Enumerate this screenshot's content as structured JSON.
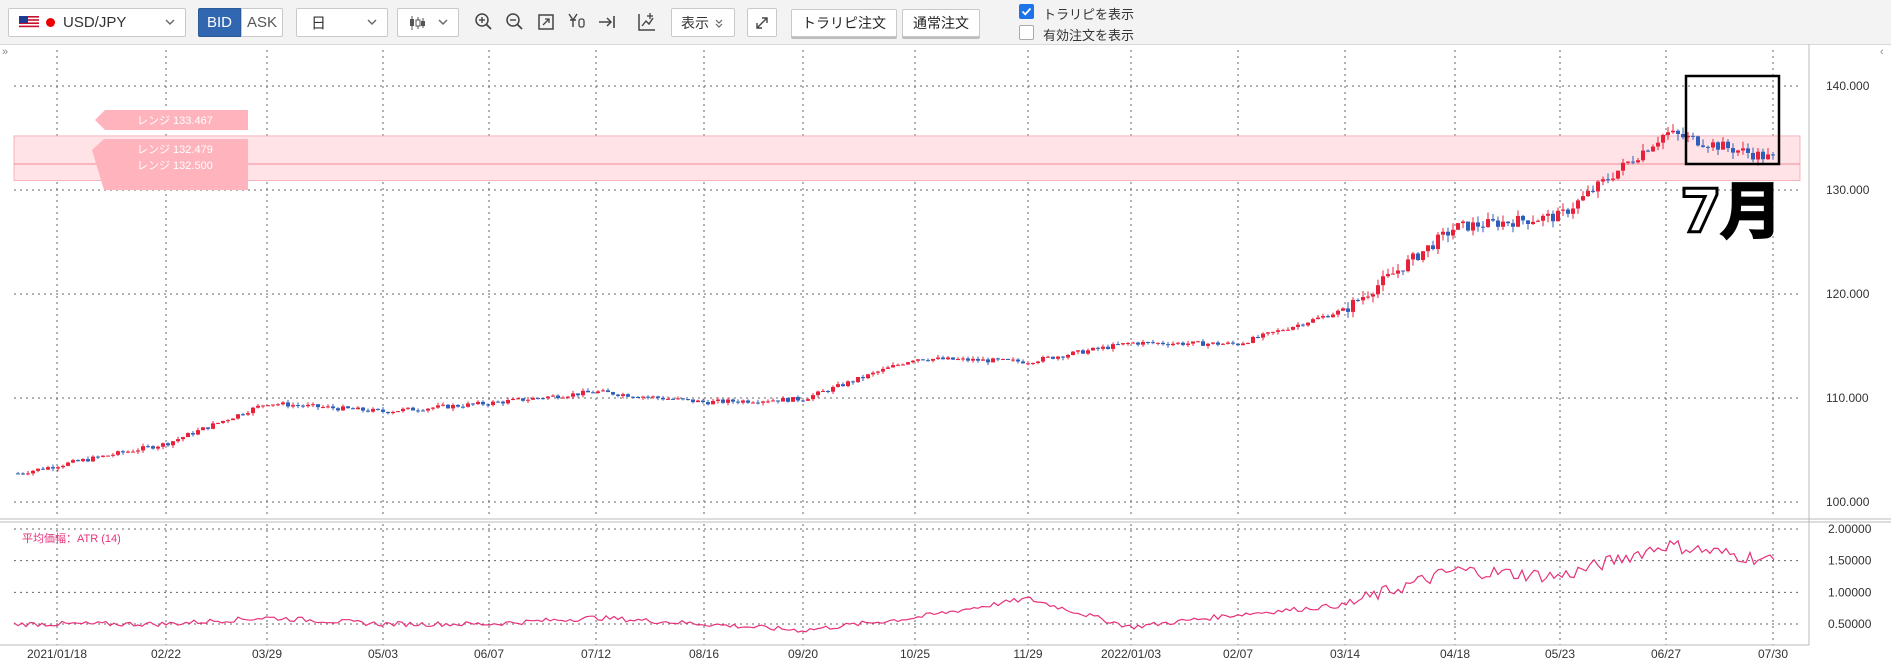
{
  "toolbar": {
    "symbol": "USD/JPY",
    "bid_label": "BID",
    "ask_label": "ASK",
    "period": "日",
    "display_label": "表示",
    "trail_order_label": "トラリピ注文",
    "normal_order_label": "通常注文",
    "show_trail_label": "トラリピを表示",
    "show_trail_checked": true,
    "show_valid_orders_label": "有効注文を表示",
    "show_valid_orders_checked": false,
    "icons": [
      "zoom-in-icon",
      "zoom-out-icon",
      "fit-icon",
      "cursor-yen-icon",
      "jump-latest-icon",
      "add-indicator-icon",
      "expand-icon"
    ]
  },
  "colors": {
    "up_candle": "#e8213b",
    "down_candle": "#2f5fba",
    "atr_line": "#e8307a",
    "range_band": "#ffd9dd",
    "accent": "#3166b0"
  },
  "range_labels": [
    "レンジ 133.467",
    "レンジ 132.479",
    "レンジ 132.500"
  ],
  "annotation": {
    "text": "7月"
  },
  "indicator": {
    "label": "平均価幅：ATR (14)"
  },
  "chart_data": [
    {
      "type": "candlestick",
      "title": "",
      "x": [
        "2021/01/18",
        "02/22",
        "03/29",
        "05/03",
        "06/07",
        "07/12",
        "08/16",
        "09/20",
        "10/25",
        "11/29",
        "2022/01/03",
        "02/07",
        "03/14",
        "04/18",
        "05/23",
        "06/27",
        "07/30"
      ],
      "close_approx": [
        103.5,
        105.6,
        109.5,
        108.7,
        109.5,
        110.6,
        109.6,
        109.9,
        113.8,
        113.5,
        115.3,
        115.2,
        118.5,
        126.4,
        127.5,
        135.5,
        133.0
      ],
      "ylim": [
        100,
        140
      ],
      "yticks": [
        "100.000",
        "110.000",
        "120.000",
        "130.000",
        "140.000"
      ],
      "range_band": [
        130.9,
        135.2
      ],
      "grid": true
    },
    {
      "type": "line",
      "title": "平均価幅：ATR (14)",
      "x": [
        "2021/01/18",
        "02/22",
        "03/29",
        "05/03",
        "06/07",
        "07/12",
        "08/16",
        "09/20",
        "10/25",
        "11/29",
        "2022/01/03",
        "02/07",
        "03/14",
        "04/18",
        "05/23",
        "06/27",
        "07/30"
      ],
      "series": [
        {
          "name": "ATR (14)",
          "values": [
            0.5,
            0.5,
            0.6,
            0.5,
            0.5,
            0.6,
            0.5,
            0.4,
            0.6,
            0.9,
            0.45,
            0.65,
            0.8,
            1.35,
            1.25,
            1.75,
            1.5
          ]
        }
      ],
      "ylim": [
        0.25,
        2.0
      ],
      "yticks": [
        "0.50000",
        "1.00000",
        "1.50000",
        "2.00000"
      ],
      "grid": true
    }
  ]
}
